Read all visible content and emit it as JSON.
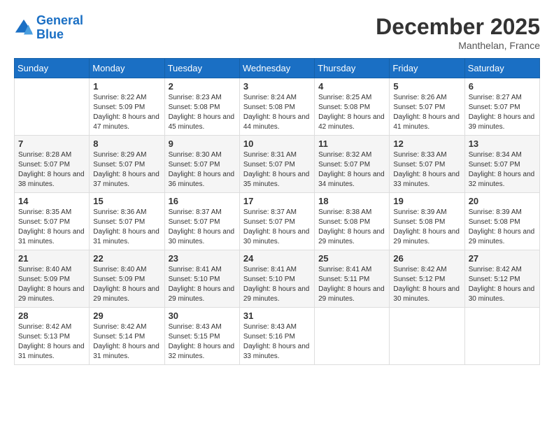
{
  "header": {
    "logo_line1": "General",
    "logo_line2": "Blue",
    "month": "December 2025",
    "location": "Manthelan, France"
  },
  "days_of_week": [
    "Sunday",
    "Monday",
    "Tuesday",
    "Wednesday",
    "Thursday",
    "Friday",
    "Saturday"
  ],
  "weeks": [
    [
      {
        "day": "",
        "sunrise": "",
        "sunset": "",
        "daylight": ""
      },
      {
        "day": "1",
        "sunrise": "Sunrise: 8:22 AM",
        "sunset": "Sunset: 5:09 PM",
        "daylight": "Daylight: 8 hours and 47 minutes."
      },
      {
        "day": "2",
        "sunrise": "Sunrise: 8:23 AM",
        "sunset": "Sunset: 5:08 PM",
        "daylight": "Daylight: 8 hours and 45 minutes."
      },
      {
        "day": "3",
        "sunrise": "Sunrise: 8:24 AM",
        "sunset": "Sunset: 5:08 PM",
        "daylight": "Daylight: 8 hours and 44 minutes."
      },
      {
        "day": "4",
        "sunrise": "Sunrise: 8:25 AM",
        "sunset": "Sunset: 5:08 PM",
        "daylight": "Daylight: 8 hours and 42 minutes."
      },
      {
        "day": "5",
        "sunrise": "Sunrise: 8:26 AM",
        "sunset": "Sunset: 5:07 PM",
        "daylight": "Daylight: 8 hours and 41 minutes."
      },
      {
        "day": "6",
        "sunrise": "Sunrise: 8:27 AM",
        "sunset": "Sunset: 5:07 PM",
        "daylight": "Daylight: 8 hours and 39 minutes."
      }
    ],
    [
      {
        "day": "7",
        "sunrise": "Sunrise: 8:28 AM",
        "sunset": "Sunset: 5:07 PM",
        "daylight": "Daylight: 8 hours and 38 minutes."
      },
      {
        "day": "8",
        "sunrise": "Sunrise: 8:29 AM",
        "sunset": "Sunset: 5:07 PM",
        "daylight": "Daylight: 8 hours and 37 minutes."
      },
      {
        "day": "9",
        "sunrise": "Sunrise: 8:30 AM",
        "sunset": "Sunset: 5:07 PM",
        "daylight": "Daylight: 8 hours and 36 minutes."
      },
      {
        "day": "10",
        "sunrise": "Sunrise: 8:31 AM",
        "sunset": "Sunset: 5:07 PM",
        "daylight": "Daylight: 8 hours and 35 minutes."
      },
      {
        "day": "11",
        "sunrise": "Sunrise: 8:32 AM",
        "sunset": "Sunset: 5:07 PM",
        "daylight": "Daylight: 8 hours and 34 minutes."
      },
      {
        "day": "12",
        "sunrise": "Sunrise: 8:33 AM",
        "sunset": "Sunset: 5:07 PM",
        "daylight": "Daylight: 8 hours and 33 minutes."
      },
      {
        "day": "13",
        "sunrise": "Sunrise: 8:34 AM",
        "sunset": "Sunset: 5:07 PM",
        "daylight": "Daylight: 8 hours and 32 minutes."
      }
    ],
    [
      {
        "day": "14",
        "sunrise": "Sunrise: 8:35 AM",
        "sunset": "Sunset: 5:07 PM",
        "daylight": "Daylight: 8 hours and 31 minutes."
      },
      {
        "day": "15",
        "sunrise": "Sunrise: 8:36 AM",
        "sunset": "Sunset: 5:07 PM",
        "daylight": "Daylight: 8 hours and 31 minutes."
      },
      {
        "day": "16",
        "sunrise": "Sunrise: 8:37 AM",
        "sunset": "Sunset: 5:07 PM",
        "daylight": "Daylight: 8 hours and 30 minutes."
      },
      {
        "day": "17",
        "sunrise": "Sunrise: 8:37 AM",
        "sunset": "Sunset: 5:07 PM",
        "daylight": "Daylight: 8 hours and 30 minutes."
      },
      {
        "day": "18",
        "sunrise": "Sunrise: 8:38 AM",
        "sunset": "Sunset: 5:08 PM",
        "daylight": "Daylight: 8 hours and 29 minutes."
      },
      {
        "day": "19",
        "sunrise": "Sunrise: 8:39 AM",
        "sunset": "Sunset: 5:08 PM",
        "daylight": "Daylight: 8 hours and 29 minutes."
      },
      {
        "day": "20",
        "sunrise": "Sunrise: 8:39 AM",
        "sunset": "Sunset: 5:08 PM",
        "daylight": "Daylight: 8 hours and 29 minutes."
      }
    ],
    [
      {
        "day": "21",
        "sunrise": "Sunrise: 8:40 AM",
        "sunset": "Sunset: 5:09 PM",
        "daylight": "Daylight: 8 hours and 29 minutes."
      },
      {
        "day": "22",
        "sunrise": "Sunrise: 8:40 AM",
        "sunset": "Sunset: 5:09 PM",
        "daylight": "Daylight: 8 hours and 29 minutes."
      },
      {
        "day": "23",
        "sunrise": "Sunrise: 8:41 AM",
        "sunset": "Sunset: 5:10 PM",
        "daylight": "Daylight: 8 hours and 29 minutes."
      },
      {
        "day": "24",
        "sunrise": "Sunrise: 8:41 AM",
        "sunset": "Sunset: 5:10 PM",
        "daylight": "Daylight: 8 hours and 29 minutes."
      },
      {
        "day": "25",
        "sunrise": "Sunrise: 8:41 AM",
        "sunset": "Sunset: 5:11 PM",
        "daylight": "Daylight: 8 hours and 29 minutes."
      },
      {
        "day": "26",
        "sunrise": "Sunrise: 8:42 AM",
        "sunset": "Sunset: 5:12 PM",
        "daylight": "Daylight: 8 hours and 30 minutes."
      },
      {
        "day": "27",
        "sunrise": "Sunrise: 8:42 AM",
        "sunset": "Sunset: 5:12 PM",
        "daylight": "Daylight: 8 hours and 30 minutes."
      }
    ],
    [
      {
        "day": "28",
        "sunrise": "Sunrise: 8:42 AM",
        "sunset": "Sunset: 5:13 PM",
        "daylight": "Daylight: 8 hours and 31 minutes."
      },
      {
        "day": "29",
        "sunrise": "Sunrise: 8:42 AM",
        "sunset": "Sunset: 5:14 PM",
        "daylight": "Daylight: 8 hours and 31 minutes."
      },
      {
        "day": "30",
        "sunrise": "Sunrise: 8:43 AM",
        "sunset": "Sunset: 5:15 PM",
        "daylight": "Daylight: 8 hours and 32 minutes."
      },
      {
        "day": "31",
        "sunrise": "Sunrise: 8:43 AM",
        "sunset": "Sunset: 5:16 PM",
        "daylight": "Daylight: 8 hours and 33 minutes."
      },
      {
        "day": "",
        "sunrise": "",
        "sunset": "",
        "daylight": ""
      },
      {
        "day": "",
        "sunrise": "",
        "sunset": "",
        "daylight": ""
      },
      {
        "day": "",
        "sunrise": "",
        "sunset": "",
        "daylight": ""
      }
    ]
  ]
}
